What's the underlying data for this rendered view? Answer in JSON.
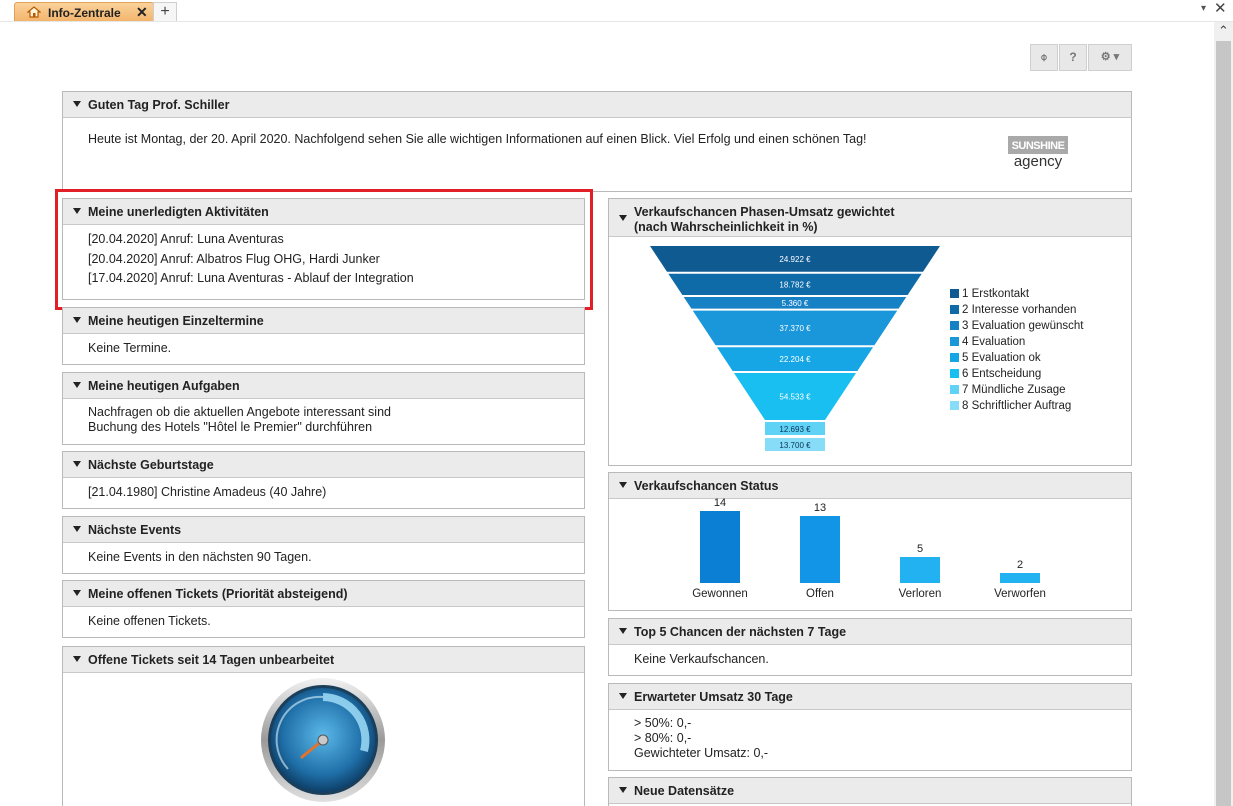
{
  "tab": {
    "label": "Info-Zentrale",
    "close": "✕",
    "add": "+"
  },
  "window": {
    "chevron": "▾",
    "close": "✕"
  },
  "toolbar": {
    "refresh": "⌽",
    "help": "?",
    "settings": "⚙ ▾"
  },
  "colors": {
    "tab_bg": "#f2b36a",
    "highlight": "#e21e26",
    "header_bg": "#ebebeb"
  },
  "panels": {
    "greeting": {
      "title": "Guten Tag Prof. Schiller",
      "text": "Heute ist Montag, der 20. April 2020. Nachfolgend sehen Sie alle wichtigen Informationen auf einen Blick. Viel Erfolg und einen schönen Tag!",
      "logo_top": "SUNSHINE",
      "logo_bottom": "agency"
    },
    "activities": {
      "title": "Meine unerledigten Aktivitäten",
      "items": [
        "[20.04.2020] Anruf: Luna Aventuras",
        "[20.04.2020] Anruf: Albatros Flug OHG, Hardi Junker",
        "[17.04.2020] Anruf: Luna Aventuras - Ablauf der Integration"
      ]
    },
    "appointments": {
      "title": "Meine heutigen Einzeltermine",
      "text": "Keine Termine."
    },
    "tasks": {
      "title": "Meine heutigen Aufgaben",
      "items": [
        "Nachfragen ob die aktuellen Angebote interessant sind",
        "Buchung des Hotels \"Hôtel le Premier\" durchführen"
      ]
    },
    "birthdays": {
      "title": "Nächste Geburtstage",
      "text": "[21.04.1980] Christine Amadeus (40 Jahre)"
    },
    "events": {
      "title": "Nächste Events",
      "text": "Keine Events in den nächsten 90 Tagen."
    },
    "tickets": {
      "title": "Meine offenen Tickets (Priorität absteigend)",
      "text": "Keine offenen Tickets."
    },
    "old_tickets": {
      "title": "Offene Tickets seit 14 Tagen unbearbeitet"
    },
    "funnel": {
      "title_line1": "Verkaufschancen Phasen-Umsatz gewichtet",
      "title_line2": "(nach Wahrscheinlichkeit in %)"
    },
    "status": {
      "title": "Verkaufschancen Status"
    },
    "top5": {
      "title": "Top 5 Chancen der nächsten 7 Tage",
      "text": "Keine Verkaufschancen."
    },
    "revenue": {
      "title": "Erwarteter Umsatz 30 Tage",
      "items": [
        "> 50%: 0,-",
        "> 80%: 0,-",
        "Gewichteter Umsatz: 0,-"
      ]
    },
    "new_records": {
      "title": "Neue Datensätze"
    }
  },
  "chart_data": [
    {
      "type": "funnel",
      "categories": [
        "1 Erstkontakt",
        "2 Interesse vorhanden",
        "3 Evaluation gewünscht",
        "4 Evaluation",
        "5 Evaluation ok",
        "6 Entscheidung",
        "7 Mündliche Zusage",
        "8 Schriftlicher Auftrag"
      ],
      "labels": [
        "24.922 €",
        "18.782 €",
        "5.360 €",
        "37.370 €",
        "22.204 €",
        "54.533 €",
        "12.693 €",
        "13.700 €"
      ],
      "values": [
        24922,
        18782,
        5360,
        37370,
        22204,
        54533,
        12693,
        13700
      ],
      "colors": [
        "#105a92",
        "#0f6aa8",
        "#1781c6",
        "#1a96da",
        "#16a6e5",
        "#19bff0",
        "#5fd2f6",
        "#87dcf7"
      ]
    },
    {
      "type": "bar",
      "categories": [
        "Gewonnen",
        "Offen",
        "Verloren",
        "Verworfen"
      ],
      "values": [
        14,
        13,
        5,
        2
      ],
      "colors": [
        "#0a7fd4",
        "#1295e6",
        "#22b2f2",
        "#22b2f2"
      ]
    }
  ]
}
